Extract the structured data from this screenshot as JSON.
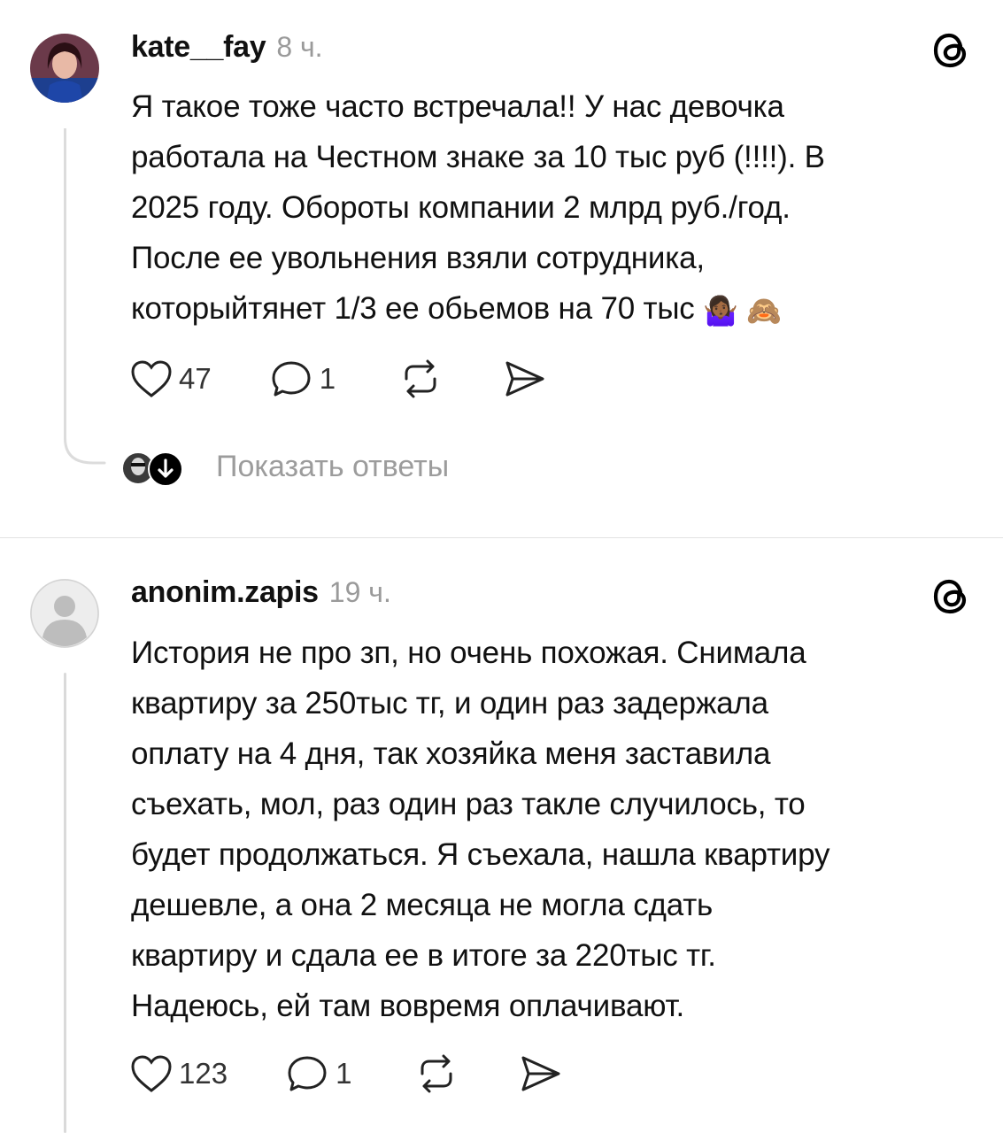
{
  "posts": [
    {
      "username": "kate__fay",
      "timestamp": "8 ч.",
      "lines": [
        "Я такое тоже часто встречала!! У нас девочка",
        "работала на Честном знаке за 10 тыс руб (!!!!). В",
        "2025 году. Обороты компании 2 млрд руб./год.",
        "После ее увольнения взяли сотрудника,",
        "которыйтянет 1/3 ее обьемов на 70 тыс"
      ],
      "emojis": [
        "🤷🏾‍♀️",
        "🙈"
      ],
      "likes": "47",
      "replies": "1",
      "show_replies": "Показать ответы",
      "icons": [
        "heart-icon",
        "comment-icon",
        "repost-icon",
        "share-icon",
        "threads-logo-icon"
      ]
    },
    {
      "username": "anonim.zapis",
      "timestamp": "19 ч.",
      "lines": [
        "История не про зп, но очень похожая. Снимала",
        "квартиру за 250тыс тг, и один раз задержала",
        "оплату на 4 дня, так хозяйка меня заставила",
        "съехать, мол, раз один раз такле случилось, то",
        "будет продолжаться. Я съехала, нашла квартиру",
        "дешевле, а она 2 месяца не могла сдать",
        "квартиру и сдала ее в итоге за 220тыс тг.",
        "Надеюсь, ей там вовремя оплачивают."
      ],
      "likes": "123",
      "replies": "1",
      "icons": [
        "heart-icon",
        "comment-icon",
        "repost-icon",
        "share-icon",
        "threads-logo-icon"
      ]
    }
  ]
}
